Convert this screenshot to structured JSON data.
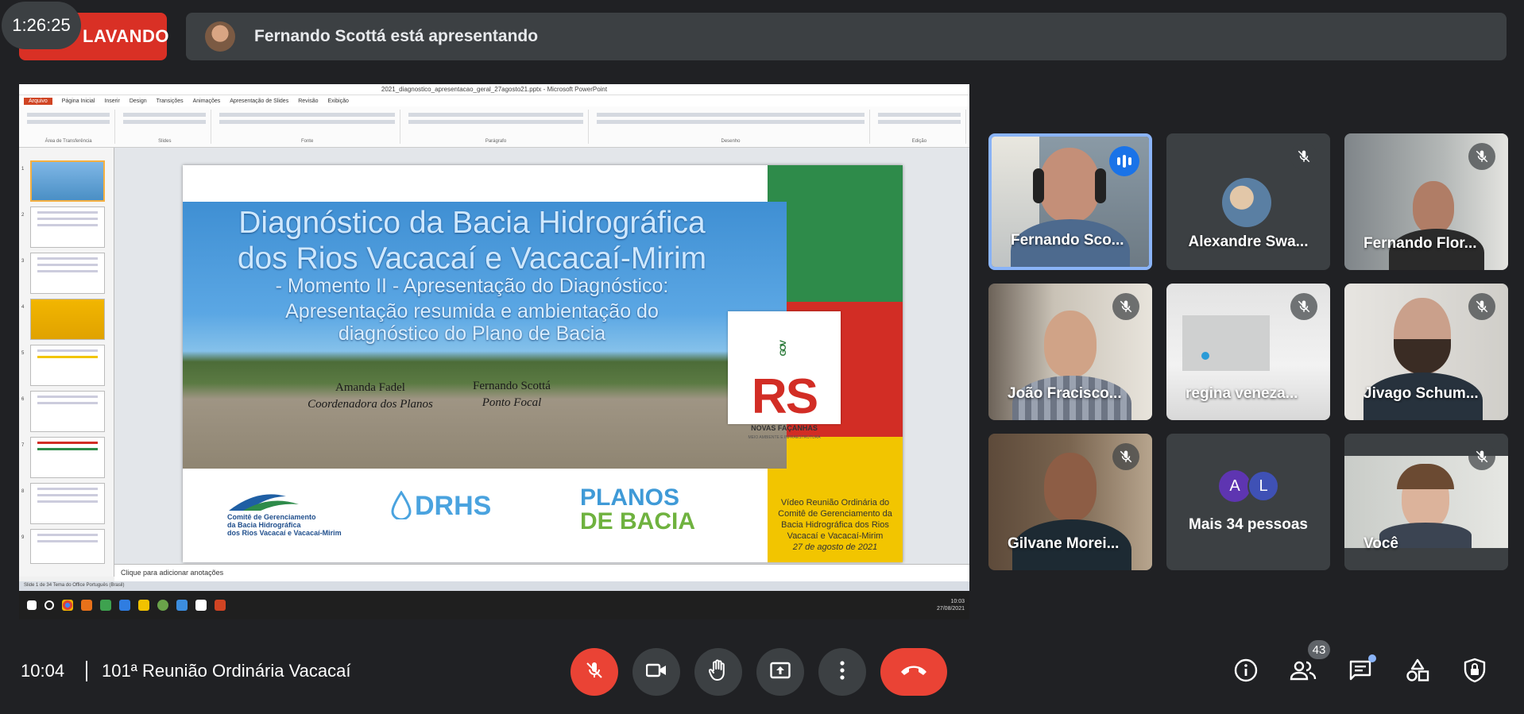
{
  "timer": "1:26:25",
  "recording": {
    "label": "LAVANDO"
  },
  "presenting": {
    "text": "Fernando Scottá está apresentando"
  },
  "ppt": {
    "window_title": "2021_diagnostico_apresentacao_geral_27agosto21.pptx - Microsoft PowerPoint",
    "tabs": [
      "Arquivo",
      "Página Inicial",
      "Inserir",
      "Design",
      "Transições",
      "Animações",
      "Apresentação de Slides",
      "Revisão",
      "Exibição"
    ],
    "ribbon_groups": [
      "Área de Transferência",
      "Slides",
      "Fonte",
      "Parágrafo",
      "Desenho",
      "Edição"
    ],
    "notes_placeholder": "Clique para adicionar anotações",
    "statusbar": "Slide 1 de 34   Tema do Office   Português (Brasil)",
    "clock_time": "10:03",
    "clock_date": "27/08/2021"
  },
  "slide": {
    "title_line1": "Diagnóstico da Bacia Hidrográfica",
    "title_line2": "dos Rios Vacacaí e Vacacaí-Mirim",
    "sub_line1": "- Momento II - Apresentação do Diagnóstico:",
    "sub_line2": "Apresentação resumida e ambientação do",
    "sub_line3": "diagnóstico do Plano de Bacia",
    "author1_name": "Amanda Fadel",
    "author1_role": "Coordenadora dos Planos",
    "author2_name": "Fernando Scottá",
    "author2_role": "Ponto Focal",
    "rs_gov": "GOV",
    "rs_logo": "RS",
    "rs_caption": "NOVAS FAÇANHAS",
    "rs_small": "MEIO AMBIENTE E INFRAESTRUTURA",
    "logo1_line1": "Comitê de Gerenciamento",
    "logo1_line2": "da Bacia Hidrográfica",
    "logo1_line3": "dos Rios Vacacaí e Vacacaí-Mirim",
    "logo2": "DRHS",
    "logo3_line1": "PLANOS",
    "logo3_line2": "DE BACIA",
    "video_line1": "Vídeo Reunião Ordinária do",
    "video_line2": "Comitê de Gerenciamento da",
    "video_line3": "Bacia Hidrográfica dos Rios",
    "video_line4": "Vacacaí e Vacacaí-Mirim",
    "video_date": "27 de agosto de 2021"
  },
  "participants": [
    {
      "name": "Fernando Sco...",
      "speaking": true,
      "muted": false
    },
    {
      "name": "Alexandre Swa...",
      "speaking": false,
      "muted": true
    },
    {
      "name": "Fernando Flor...",
      "speaking": false,
      "muted": true
    },
    {
      "name": "João Fracisco...",
      "speaking": false,
      "muted": true
    },
    {
      "name": "regina veneza...",
      "speaking": false,
      "muted": true
    },
    {
      "name": "Jivago Schum...",
      "speaking": false,
      "muted": true
    },
    {
      "name": "Gilvane Morei...",
      "speaking": false,
      "muted": true
    },
    {
      "name": "Mais 34 pessoas",
      "avatars": [
        "A",
        "L"
      ]
    },
    {
      "name": "Você",
      "speaking": false,
      "muted": true
    }
  ],
  "bottom": {
    "time": "10:04",
    "meeting_title": "101ª Reunião Ordinária Vacacaí",
    "people_count": "43"
  },
  "colors": {
    "background": "#202124",
    "surface": "#3c4043",
    "danger": "#ea4335",
    "speaking_border": "#8ab4f8",
    "flag_green": "#2e8b4a",
    "flag_red": "#d22d25",
    "flag_yellow": "#f2c500"
  },
  "icons": [
    "mic-off-icon",
    "camera-icon",
    "raise-hand-icon",
    "present-icon",
    "more-options-icon",
    "end-call-icon",
    "info-icon",
    "people-icon",
    "chat-icon",
    "activities-icon",
    "host-controls-icon"
  ]
}
